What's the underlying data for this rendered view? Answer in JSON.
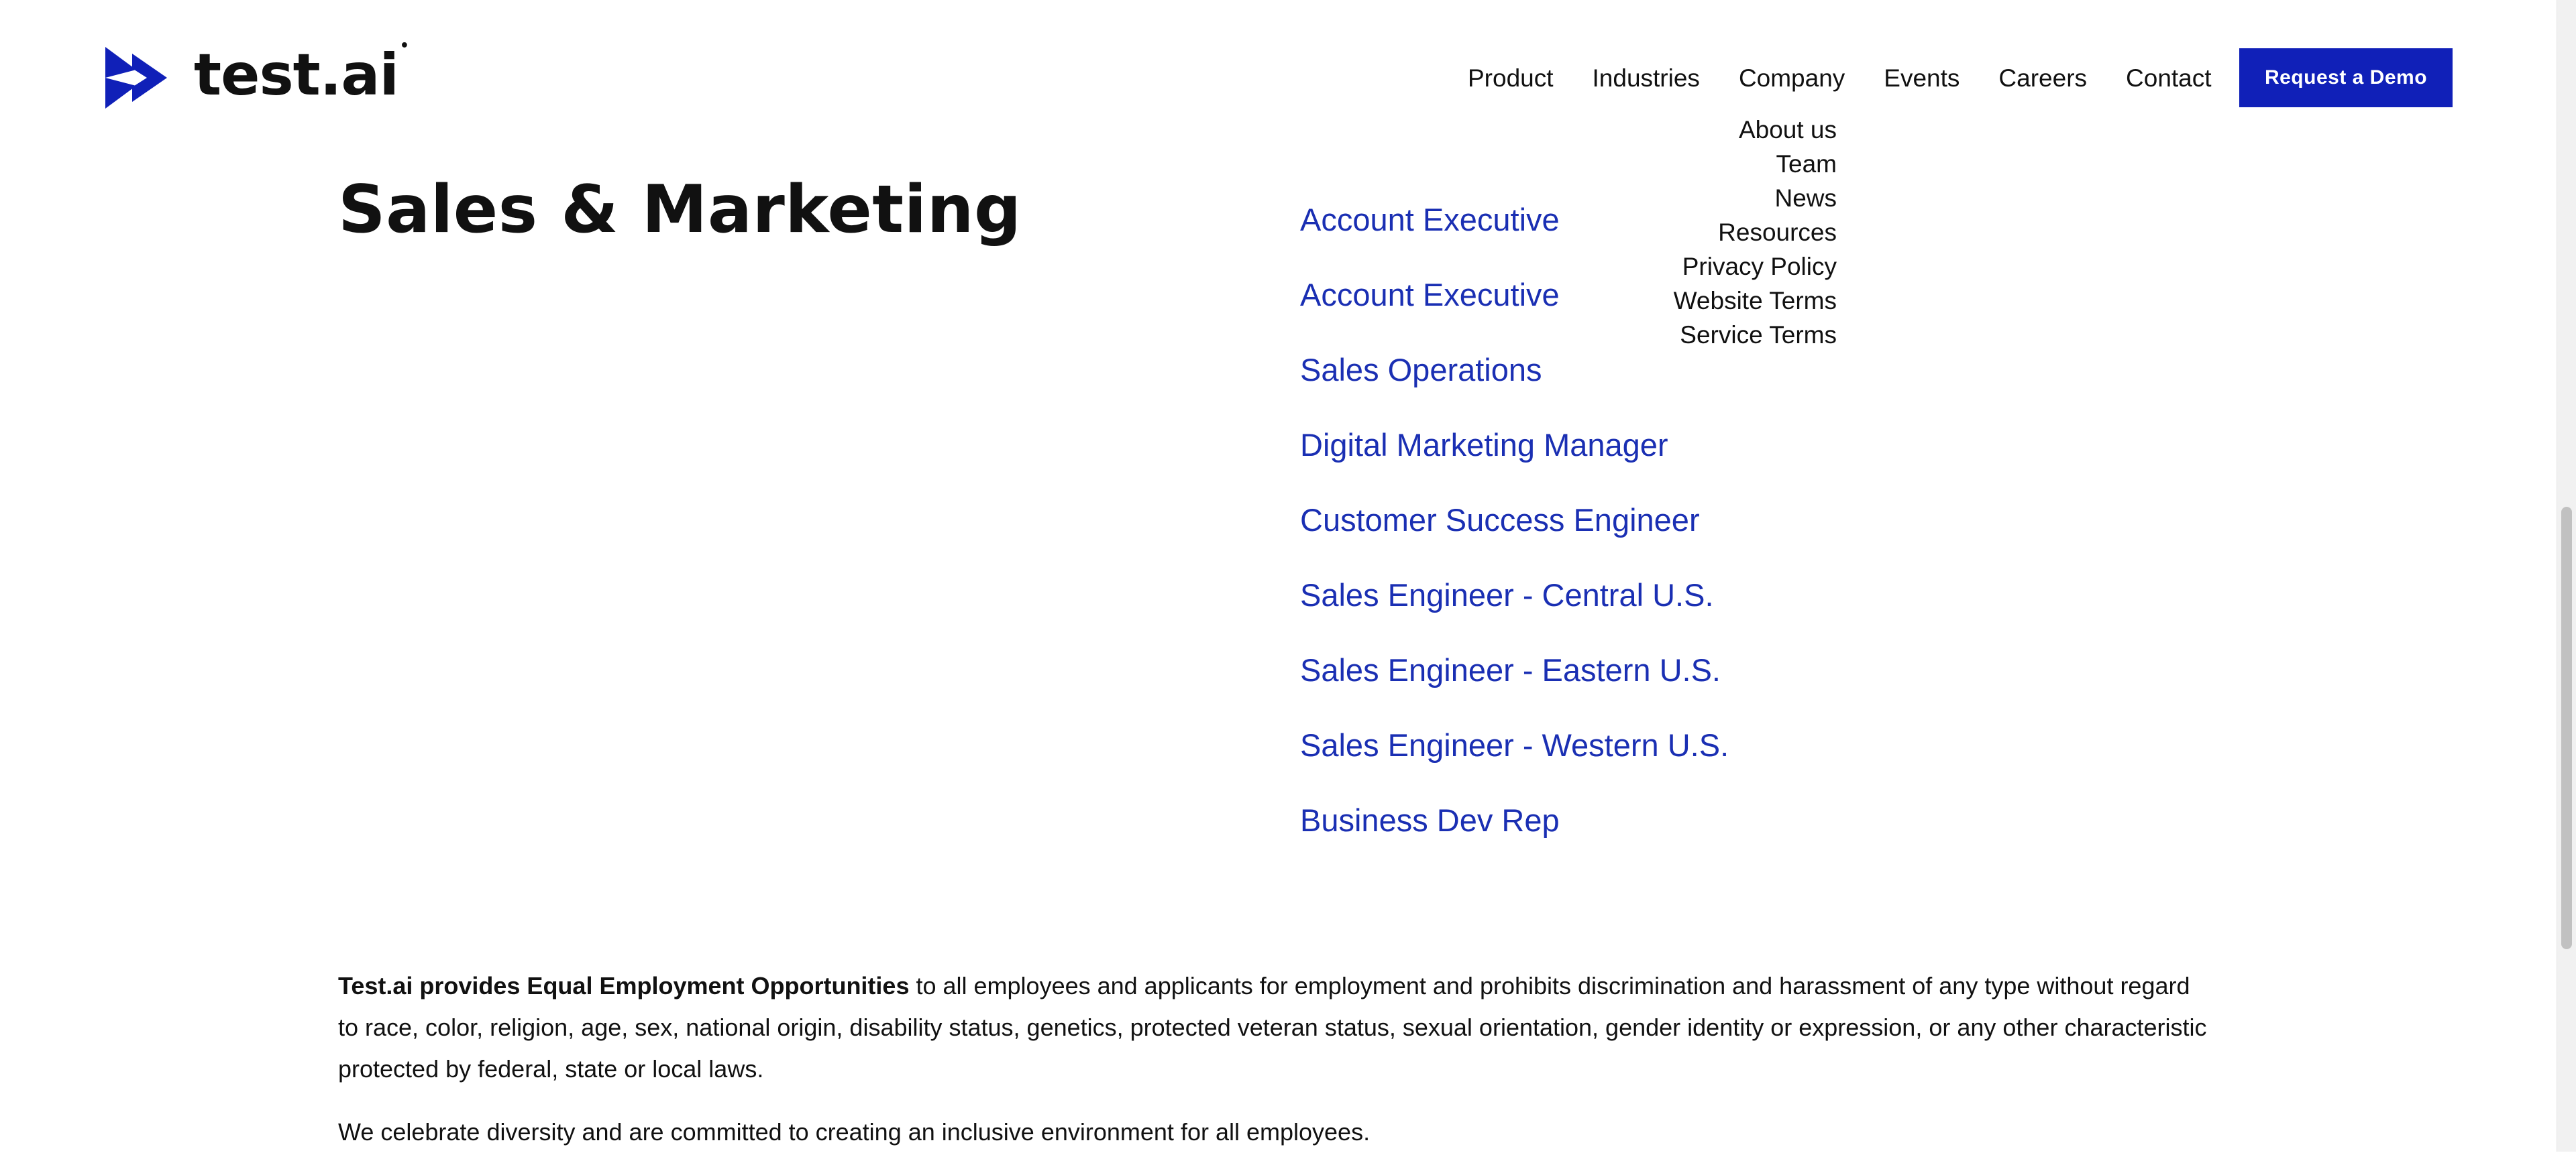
{
  "brand": {
    "name": "test.ai",
    "mark": "•",
    "accent_color": "#1020b8",
    "link_color": "#1a2fb3"
  },
  "nav": {
    "items": [
      {
        "label": "Product"
      },
      {
        "label": "Industries"
      },
      {
        "label": "Company"
      },
      {
        "label": "Events"
      },
      {
        "label": "Careers"
      },
      {
        "label": "Contact"
      }
    ],
    "cta_label": "Request a Demo"
  },
  "company_menu": {
    "items": [
      {
        "label": "About us"
      },
      {
        "label": "Team"
      },
      {
        "label": "News"
      },
      {
        "label": "Resources"
      },
      {
        "label": "Privacy Policy"
      },
      {
        "label": "Website Terms"
      },
      {
        "label": "Service Terms"
      }
    ]
  },
  "section": {
    "title": "Sales & Marketing",
    "jobs": [
      {
        "label": "Account Executive"
      },
      {
        "label": "Account Executive"
      },
      {
        "label": "Sales Operations"
      },
      {
        "label": "Digital Marketing Manager"
      },
      {
        "label": "Customer Success Engineer"
      },
      {
        "label": "Sales Engineer - Central U.S."
      },
      {
        "label": "Sales Engineer - Eastern U.S."
      },
      {
        "label": "Sales Engineer - Western U.S."
      },
      {
        "label": "Business Dev Rep"
      }
    ]
  },
  "eeo": {
    "lead": "Test.ai provides Equal Employment Opportunities",
    "body": " to all employees and applicants for employment and prohibits discrimination and harassment of any type without regard to race, color, religion, age, sex, national origin, disability status, genetics, protected veteran status, sexual orientation, gender identity or expression, or any other characteristic protected by federal, state or local laws.",
    "diversity": "We celebrate diversity and are committed to creating an inclusive environment for all employees."
  }
}
